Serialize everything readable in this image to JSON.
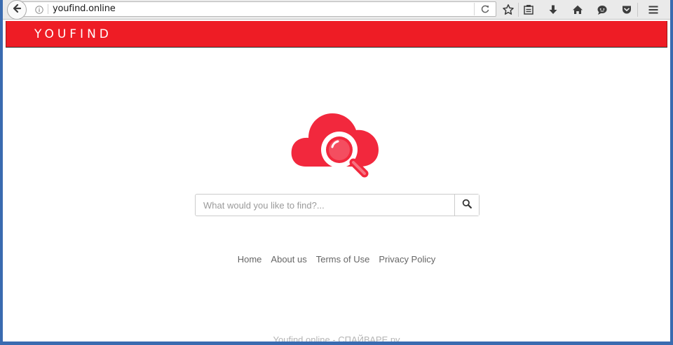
{
  "browser": {
    "url": "youfind.online",
    "toolbar_icons": [
      "back-icon",
      "info-icon",
      "reload-icon",
      "bookmark-star-icon",
      "reading-list-icon",
      "download-icon",
      "home-icon",
      "chat-icon",
      "pocket-icon",
      "menu-icon"
    ]
  },
  "site": {
    "brand": "YOUFIND",
    "search": {
      "placeholder": "What would you like to find?...",
      "value": ""
    },
    "footer_links": [
      "Home",
      "About us",
      "Terms of Use",
      "Privacy Policy"
    ],
    "watermark": "Youfind.online - СПАЙВАРЕ.ру"
  },
  "colors": {
    "brand_red": "#ee1c25",
    "logo_red": "#f2283d",
    "window_blue": "#3a6bb0"
  }
}
